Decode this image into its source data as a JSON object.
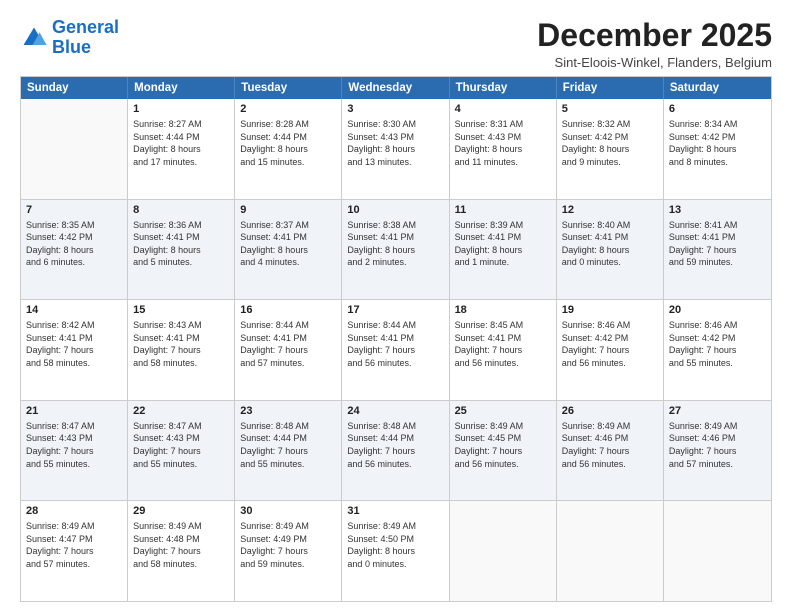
{
  "logo": {
    "general": "General",
    "blue": "Blue"
  },
  "title": "December 2025",
  "subtitle": "Sint-Eloois-Winkel, Flanders, Belgium",
  "header_days": [
    "Sunday",
    "Monday",
    "Tuesday",
    "Wednesday",
    "Thursday",
    "Friday",
    "Saturday"
  ],
  "rows": [
    [
      {
        "day": "",
        "info": ""
      },
      {
        "day": "1",
        "info": "Sunrise: 8:27 AM\nSunset: 4:44 PM\nDaylight: 8 hours\nand 17 minutes."
      },
      {
        "day": "2",
        "info": "Sunrise: 8:28 AM\nSunset: 4:44 PM\nDaylight: 8 hours\nand 15 minutes."
      },
      {
        "day": "3",
        "info": "Sunrise: 8:30 AM\nSunset: 4:43 PM\nDaylight: 8 hours\nand 13 minutes."
      },
      {
        "day": "4",
        "info": "Sunrise: 8:31 AM\nSunset: 4:43 PM\nDaylight: 8 hours\nand 11 minutes."
      },
      {
        "day": "5",
        "info": "Sunrise: 8:32 AM\nSunset: 4:42 PM\nDaylight: 8 hours\nand 9 minutes."
      },
      {
        "day": "6",
        "info": "Sunrise: 8:34 AM\nSunset: 4:42 PM\nDaylight: 8 hours\nand 8 minutes."
      }
    ],
    [
      {
        "day": "7",
        "info": "Sunrise: 8:35 AM\nSunset: 4:42 PM\nDaylight: 8 hours\nand 6 minutes."
      },
      {
        "day": "8",
        "info": "Sunrise: 8:36 AM\nSunset: 4:41 PM\nDaylight: 8 hours\nand 5 minutes."
      },
      {
        "day": "9",
        "info": "Sunrise: 8:37 AM\nSunset: 4:41 PM\nDaylight: 8 hours\nand 4 minutes."
      },
      {
        "day": "10",
        "info": "Sunrise: 8:38 AM\nSunset: 4:41 PM\nDaylight: 8 hours\nand 2 minutes."
      },
      {
        "day": "11",
        "info": "Sunrise: 8:39 AM\nSunset: 4:41 PM\nDaylight: 8 hours\nand 1 minute."
      },
      {
        "day": "12",
        "info": "Sunrise: 8:40 AM\nSunset: 4:41 PM\nDaylight: 8 hours\nand 0 minutes."
      },
      {
        "day": "13",
        "info": "Sunrise: 8:41 AM\nSunset: 4:41 PM\nDaylight: 7 hours\nand 59 minutes."
      }
    ],
    [
      {
        "day": "14",
        "info": "Sunrise: 8:42 AM\nSunset: 4:41 PM\nDaylight: 7 hours\nand 58 minutes."
      },
      {
        "day": "15",
        "info": "Sunrise: 8:43 AM\nSunset: 4:41 PM\nDaylight: 7 hours\nand 58 minutes."
      },
      {
        "day": "16",
        "info": "Sunrise: 8:44 AM\nSunset: 4:41 PM\nDaylight: 7 hours\nand 57 minutes."
      },
      {
        "day": "17",
        "info": "Sunrise: 8:44 AM\nSunset: 4:41 PM\nDaylight: 7 hours\nand 56 minutes."
      },
      {
        "day": "18",
        "info": "Sunrise: 8:45 AM\nSunset: 4:41 PM\nDaylight: 7 hours\nand 56 minutes."
      },
      {
        "day": "19",
        "info": "Sunrise: 8:46 AM\nSunset: 4:42 PM\nDaylight: 7 hours\nand 56 minutes."
      },
      {
        "day": "20",
        "info": "Sunrise: 8:46 AM\nSunset: 4:42 PM\nDaylight: 7 hours\nand 55 minutes."
      }
    ],
    [
      {
        "day": "21",
        "info": "Sunrise: 8:47 AM\nSunset: 4:43 PM\nDaylight: 7 hours\nand 55 minutes."
      },
      {
        "day": "22",
        "info": "Sunrise: 8:47 AM\nSunset: 4:43 PM\nDaylight: 7 hours\nand 55 minutes."
      },
      {
        "day": "23",
        "info": "Sunrise: 8:48 AM\nSunset: 4:44 PM\nDaylight: 7 hours\nand 55 minutes."
      },
      {
        "day": "24",
        "info": "Sunrise: 8:48 AM\nSunset: 4:44 PM\nDaylight: 7 hours\nand 56 minutes."
      },
      {
        "day": "25",
        "info": "Sunrise: 8:49 AM\nSunset: 4:45 PM\nDaylight: 7 hours\nand 56 minutes."
      },
      {
        "day": "26",
        "info": "Sunrise: 8:49 AM\nSunset: 4:46 PM\nDaylight: 7 hours\nand 56 minutes."
      },
      {
        "day": "27",
        "info": "Sunrise: 8:49 AM\nSunset: 4:46 PM\nDaylight: 7 hours\nand 57 minutes."
      }
    ],
    [
      {
        "day": "28",
        "info": "Sunrise: 8:49 AM\nSunset: 4:47 PM\nDaylight: 7 hours\nand 57 minutes."
      },
      {
        "day": "29",
        "info": "Sunrise: 8:49 AM\nSunset: 4:48 PM\nDaylight: 7 hours\nand 58 minutes."
      },
      {
        "day": "30",
        "info": "Sunrise: 8:49 AM\nSunset: 4:49 PM\nDaylight: 7 hours\nand 59 minutes."
      },
      {
        "day": "31",
        "info": "Sunrise: 8:49 AM\nSunset: 4:50 PM\nDaylight: 8 hours\nand 0 minutes."
      },
      {
        "day": "",
        "info": ""
      },
      {
        "day": "",
        "info": ""
      },
      {
        "day": "",
        "info": ""
      }
    ]
  ]
}
